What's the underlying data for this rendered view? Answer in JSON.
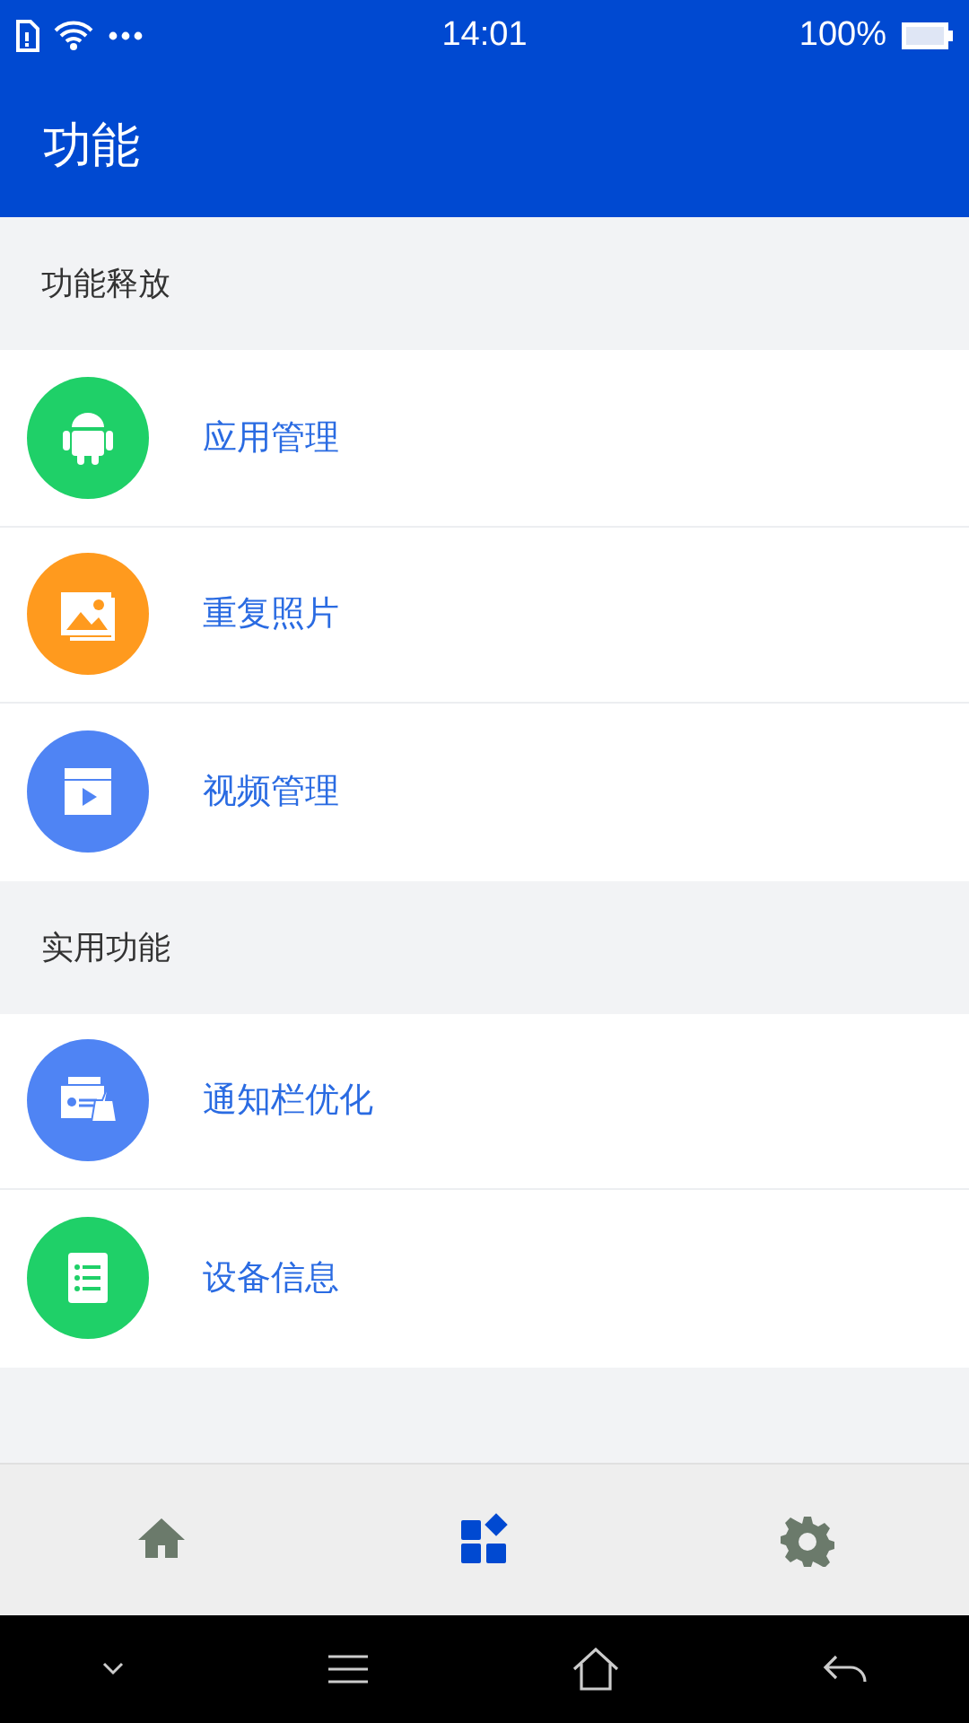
{
  "status_bar": {
    "time": "14:01",
    "battery": "100%"
  },
  "app_bar": {
    "title": "功能"
  },
  "sections": [
    {
      "title": "功能释放",
      "items": [
        {
          "kind": "android",
          "label": "应用管理",
          "color": "#1fd068"
        },
        {
          "kind": "photos",
          "label": "重复照片",
          "color": "#ff9a1e"
        },
        {
          "kind": "video",
          "label": "视频管理",
          "color": "#4f84f4"
        }
      ]
    },
    {
      "title": "实用功能",
      "items": [
        {
          "kind": "clean",
          "label": "通知栏优化",
          "color": "#4f84f4"
        },
        {
          "kind": "list",
          "label": "设备信息",
          "color": "#1fd068"
        }
      ]
    }
  ],
  "bottom_nav": [
    {
      "kind": "home",
      "selected": false
    },
    {
      "kind": "apps",
      "selected": true
    },
    {
      "kind": "settings",
      "selected": false
    }
  ]
}
